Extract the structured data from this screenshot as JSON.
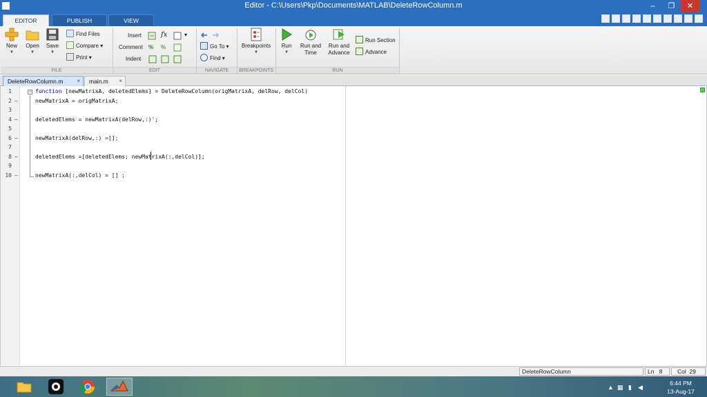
{
  "window": {
    "title": "Editor - C:\\Users\\Pkp\\Documents\\MATLAB\\DeleteRowColumn.m",
    "minimize": "–",
    "maximize": "❐",
    "close": "✕"
  },
  "tabs": [
    {
      "label": "EDITOR",
      "active": true
    },
    {
      "label": "PUBLISH",
      "active": false
    },
    {
      "label": "VIEW",
      "active": false
    }
  ],
  "ribbon": {
    "file": {
      "group_label": "FILE",
      "new": "New",
      "open": "Open",
      "save": "Save",
      "find_files": "Find Files",
      "compare": "Compare",
      "print": "Print"
    },
    "edit": {
      "group_label": "EDIT",
      "insert": "Insert",
      "comment": "Comment",
      "indent": "Indent",
      "fx": "fx"
    },
    "navigate": {
      "group_label": "NAVIGATE",
      "go_to": "Go To",
      "find": "Find"
    },
    "breakpoints": {
      "group_label": "BREAKPOINTS",
      "breakpoints": "Breakpoints"
    },
    "run": {
      "group_label": "RUN",
      "run": "Run",
      "run_and_time_1": "Run and",
      "run_and_time_2": "Time",
      "run_and_advance_1": "Run and",
      "run_and_advance_2": "Advance",
      "run_section": "Run Section",
      "advance": "Advance"
    }
  },
  "doc_tabs": [
    {
      "label": "DeleteRowColumn.m",
      "close": "×",
      "active": true
    },
    {
      "label": "main.m",
      "close": "×",
      "active": false
    }
  ],
  "editor": {
    "lines": [
      {
        "num": "1",
        "marker": "",
        "code_kw": "function",
        "code": " [newMatrixA, deletedElems] = DeleteRowColumn(origMatrixA, delRow, delCol)"
      },
      {
        "num": "2",
        "marker": "–",
        "code_kw": "",
        "code": "newMatrixA = origMatrixA;"
      },
      {
        "num": "3",
        "marker": "",
        "code_kw": "",
        "code": ""
      },
      {
        "num": "4",
        "marker": "–",
        "code_kw": "",
        "code": "deletedElems = newMatrixA(delRow,:)';"
      },
      {
        "num": "5",
        "marker": "",
        "code_kw": "",
        "code": ""
      },
      {
        "num": "6",
        "marker": "–",
        "code_kw": "",
        "code": "newMatrixA(delRow,:) =[];"
      },
      {
        "num": "7",
        "marker": "",
        "code_kw": "",
        "code": ""
      },
      {
        "num": "8",
        "marker": "–",
        "code_kw": "",
        "code": "deletedElems =[deletedElems; newMatrixA(:,delCol)];"
      },
      {
        "num": "9",
        "marker": "",
        "code_kw": "",
        "code": ""
      },
      {
        "num": "10",
        "marker": "–",
        "code_kw": "",
        "code": "newMatrixA(:,delCol) = [] ;"
      }
    ],
    "fold_symbol": "−"
  },
  "status": {
    "function_name": "DeleteRowColumn",
    "ln_label": "Ln",
    "ln_value": "8",
    "col_label": "Col",
    "col_value": "29"
  },
  "taskbar": {
    "time": "6:44 PM",
    "date": "13-Aug-17",
    "tray_arrow": "▲"
  },
  "colors": {
    "title_bar": "#2c6fc0",
    "close_button": "#c7392c",
    "keyword": "#0000ff",
    "active_doc_tab": "#d6e6fa"
  }
}
